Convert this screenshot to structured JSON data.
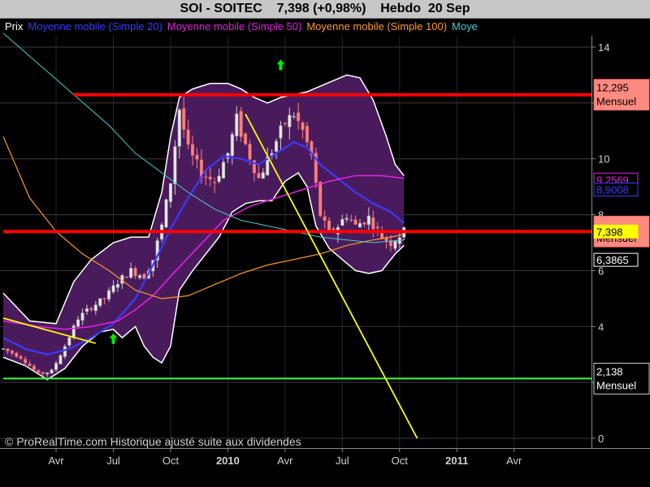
{
  "header": {
    "title": "SOI - SOITEC    7,398 (+0,98%)    Hebdo  20 Sep"
  },
  "legend": [
    {
      "label": "Prix",
      "color": "#ffffff"
    },
    {
      "label": "Moyenne mobile (Simple 20)",
      "color": "#3a3aff"
    },
    {
      "label": "Moyenne mobile (Simple 50)",
      "color": "#e020e0"
    },
    {
      "label": "Moyenne mobile (Simple 100)",
      "color": "#ff9a20"
    },
    {
      "label": "Moye",
      "color": "#40d0d0"
    }
  ],
  "footer": {
    "credit": "© ProRealTime.com Historique ajusté suite aux dividendes"
  },
  "colors": {
    "background": "#000000",
    "bollinger_fill": "#4a1b5c",
    "bollinger_edge": "#ffffff",
    "support_line": "#ff0000",
    "trend_line": "#ffff00",
    "low_line": "#40ff40",
    "candle_up": "#cccccc",
    "candle_down": "#ff8080"
  },
  "chart_data": {
    "type": "candlestick",
    "title": "SOI - SOITEC",
    "ylim": [
      0,
      14.5
    ],
    "y_ticks": [
      {
        "value": 0,
        "label": "0"
      },
      {
        "value": 2,
        "label": "2"
      },
      {
        "value": 4,
        "label": "4"
      },
      {
        "value": 6,
        "label": "6"
      },
      {
        "value": 8,
        "label": "8"
      },
      {
        "value": 10,
        "label": "10"
      },
      {
        "value": 12,
        "label": "12"
      },
      {
        "value": 14,
        "label": "14"
      }
    ],
    "x_ticks": [
      {
        "week": 12,
        "label": "Avr",
        "bold": false
      },
      {
        "week": 25,
        "label": "Jul",
        "bold": false
      },
      {
        "week": 38,
        "label": "Oct",
        "bold": false
      },
      {
        "week": 51,
        "label": "2010",
        "bold": true
      },
      {
        "week": 64,
        "label": "Avr",
        "bold": false
      },
      {
        "week": 77,
        "label": "Jul",
        "bold": false
      },
      {
        "week": 90,
        "label": "Oct",
        "bold": false
      },
      {
        "week": 103,
        "label": "2011",
        "bold": true
      },
      {
        "week": 116,
        "label": "Avr",
        "bold": false
      }
    ],
    "last_week": 91,
    "close_path": [
      [
        0,
        3.2
      ],
      [
        4,
        2.9
      ],
      [
        8,
        2.3
      ],
      [
        11,
        2.4
      ],
      [
        14,
        3.3
      ],
      [
        17,
        4.3
      ],
      [
        20,
        4.7
      ],
      [
        23,
        5.0
      ],
      [
        26,
        5.6
      ],
      [
        29,
        6.0
      ],
      [
        32,
        5.8
      ],
      [
        34,
        6.4
      ],
      [
        36,
        7.6
      ],
      [
        38,
        9.2
      ],
      [
        40,
        11.8
      ],
      [
        42,
        10.3
      ],
      [
        45,
        9.5
      ],
      [
        48,
        9.2
      ],
      [
        51,
        10.2
      ],
      [
        53,
        11.4
      ],
      [
        55,
        10.5
      ],
      [
        58,
        9.3
      ],
      [
        61,
        10.3
      ],
      [
        64,
        11.3
      ],
      [
        66,
        11.6
      ],
      [
        68,
        11.0
      ],
      [
        70,
        10.1
      ],
      [
        72,
        8.0
      ],
      [
        74,
        7.3
      ],
      [
        76,
        7.6
      ],
      [
        78,
        8.0
      ],
      [
        80,
        7.6
      ],
      [
        83,
        7.9
      ],
      [
        86,
        7.2
      ],
      [
        88,
        7.0
      ],
      [
        91,
        7.4
      ]
    ],
    "bollinger_upper": [
      [
        0,
        5.2
      ],
      [
        6,
        4.2
      ],
      [
        12,
        4.1
      ],
      [
        16,
        5.6
      ],
      [
        20,
        6.4
      ],
      [
        25,
        7.0
      ],
      [
        29,
        7.2
      ],
      [
        33,
        7.2
      ],
      [
        36,
        8.8
      ],
      [
        38,
        10.8
      ],
      [
        40,
        12.2
      ],
      [
        43,
        12.5
      ],
      [
        47,
        12.7
      ],
      [
        51,
        12.7
      ],
      [
        54,
        12.5
      ],
      [
        57,
        12.2
      ],
      [
        60,
        12.0
      ],
      [
        63,
        12.2
      ],
      [
        66,
        12.3
      ],
      [
        69,
        12.4
      ],
      [
        72,
        12.6
      ],
      [
        75,
        12.8
      ],
      [
        78,
        13.0
      ],
      [
        81,
        12.9
      ],
      [
        84,
        12.1
      ],
      [
        87,
        10.8
      ],
      [
        89,
        9.8
      ],
      [
        91,
        9.4
      ]
    ],
    "bollinger_lower": [
      [
        0,
        2.9
      ],
      [
        5,
        2.6
      ],
      [
        10,
        2.1
      ],
      [
        14,
        2.5
      ],
      [
        18,
        3.3
      ],
      [
        22,
        3.8
      ],
      [
        25,
        3.9
      ],
      [
        27,
        3.6
      ],
      [
        30,
        4.0
      ],
      [
        32,
        3.3
      ],
      [
        34,
        2.9
      ],
      [
        36,
        2.7
      ],
      [
        38,
        3.3
      ],
      [
        40,
        5.3
      ],
      [
        43,
        6.0
      ],
      [
        46,
        6.6
      ],
      [
        49,
        7.2
      ],
      [
        52,
        8.1
      ],
      [
        55,
        8.4
      ],
      [
        58,
        8.5
      ],
      [
        61,
        8.5
      ],
      [
        64,
        9.2
      ],
      [
        67,
        9.5
      ],
      [
        69,
        9.0
      ],
      [
        71,
        7.6
      ],
      [
        74,
        6.8
      ],
      [
        77,
        6.4
      ],
      [
        80,
        6.0
      ],
      [
        83,
        5.9
      ],
      [
        86,
        6.0
      ],
      [
        89,
        6.6
      ],
      [
        91,
        6.9
      ]
    ],
    "series": [
      {
        "name": "Moyenne mobile (Simple 20)",
        "color": "#3a3aff",
        "width": 2.2,
        "points": [
          [
            0,
            3.6
          ],
          [
            5,
            3.2
          ],
          [
            10,
            3.0
          ],
          [
            15,
            3.2
          ],
          [
            20,
            3.6
          ],
          [
            25,
            4.1
          ],
          [
            30,
            5.0
          ],
          [
            34,
            6.2
          ],
          [
            38,
            7.5
          ],
          [
            42,
            8.6
          ],
          [
            46,
            9.6
          ],
          [
            50,
            10.1
          ],
          [
            54,
            10.0
          ],
          [
            58,
            9.8
          ],
          [
            62,
            10.2
          ],
          [
            66,
            10.6
          ],
          [
            69,
            10.4
          ],
          [
            72,
            9.8
          ],
          [
            76,
            9.3
          ],
          [
            80,
            8.8
          ],
          [
            84,
            8.4
          ],
          [
            88,
            8.1
          ],
          [
            91,
            7.7
          ]
        ]
      },
      {
        "name": "Moyenne mobile (Simple 50)",
        "color": "#e020e0",
        "width": 1.6,
        "points": [
          [
            0,
            4.2
          ],
          [
            8,
            4.0
          ],
          [
            14,
            3.9
          ],
          [
            20,
            4.0
          ],
          [
            26,
            4.2
          ],
          [
            30,
            4.6
          ],
          [
            34,
            5.1
          ],
          [
            38,
            5.8
          ],
          [
            44,
            6.8
          ],
          [
            50,
            7.8
          ],
          [
            56,
            8.3
          ],
          [
            62,
            8.6
          ],
          [
            68,
            8.9
          ],
          [
            74,
            9.2
          ],
          [
            80,
            9.4
          ],
          [
            86,
            9.4
          ],
          [
            91,
            9.3
          ]
        ]
      },
      {
        "name": "Moyenne mobile (Simple 100)",
        "color": "#ff9a20",
        "width": 1.2,
        "points": [
          [
            0,
            10.8
          ],
          [
            6,
            8.6
          ],
          [
            12,
            7.4
          ],
          [
            18,
            6.6
          ],
          [
            24,
            6.0
          ],
          [
            30,
            5.3
          ],
          [
            36,
            5.0
          ],
          [
            42,
            5.1
          ],
          [
            48,
            5.5
          ],
          [
            54,
            5.9
          ],
          [
            60,
            6.2
          ],
          [
            66,
            6.4
          ],
          [
            72,
            6.6
          ],
          [
            78,
            6.9
          ],
          [
            84,
            7.1
          ],
          [
            88,
            7.2
          ],
          [
            91,
            7.3
          ]
        ]
      },
      {
        "name": "Moye",
        "color": "#40d0d0",
        "width": 1.0,
        "points": [
          [
            0,
            14.5
          ],
          [
            8,
            13.4
          ],
          [
            16,
            12.3
          ],
          [
            24,
            11.2
          ],
          [
            30,
            10.2
          ],
          [
            36,
            9.5
          ],
          [
            42,
            8.8
          ],
          [
            48,
            8.2
          ],
          [
            54,
            7.8
          ],
          [
            60,
            7.6
          ],
          [
            66,
            7.4
          ],
          [
            72,
            7.2
          ],
          [
            78,
            7.1
          ],
          [
            84,
            7.0
          ],
          [
            91,
            7.1
          ]
        ]
      }
    ],
    "horizontal_lines": [
      {
        "value": 12.295,
        "color": "#ff0000",
        "width": 4,
        "x_start_week": 16,
        "label": "12,295",
        "sublabel": "Mensuel",
        "badge_color": "#ff8a80"
      },
      {
        "value": 7.4,
        "color": "#ff0000",
        "width": 4,
        "x_start_week": 0,
        "label": "",
        "sublabel": "Mensuel",
        "badge_color": "#ff8a80"
      },
      {
        "value": 2.138,
        "color": "#40ff40",
        "width": 2,
        "x_start_week": 0,
        "label": "2,138",
        "sublabel": "Mensuel",
        "badge_color": "#000000"
      }
    ],
    "trend_lines": [
      {
        "color": "#ffff00",
        "from": [
          0,
          4.3
        ],
        "to": [
          21,
          3.4
        ]
      },
      {
        "color": "#ffff00",
        "from": [
          55,
          11.6
        ],
        "to": [
          94,
          0
        ]
      }
    ],
    "price_badges": [
      {
        "value": 9.2569,
        "label": "9,2569",
        "color": "#e020e0"
      },
      {
        "value": 8.9008,
        "label": "8,9008",
        "color": "#3a3aff"
      },
      {
        "value": 7.398,
        "label": "7,398",
        "color": "#ffff00"
      },
      {
        "value": 6.3865,
        "label": "6,3865",
        "color": "#ffffff"
      }
    ],
    "signal_arrows": [
      {
        "week": 25,
        "value": 3.55,
        "direction": "up",
        "color": "#00ee00"
      },
      {
        "week": 63,
        "value": 13.35,
        "direction": "up",
        "color": "#00ee00"
      }
    ]
  }
}
